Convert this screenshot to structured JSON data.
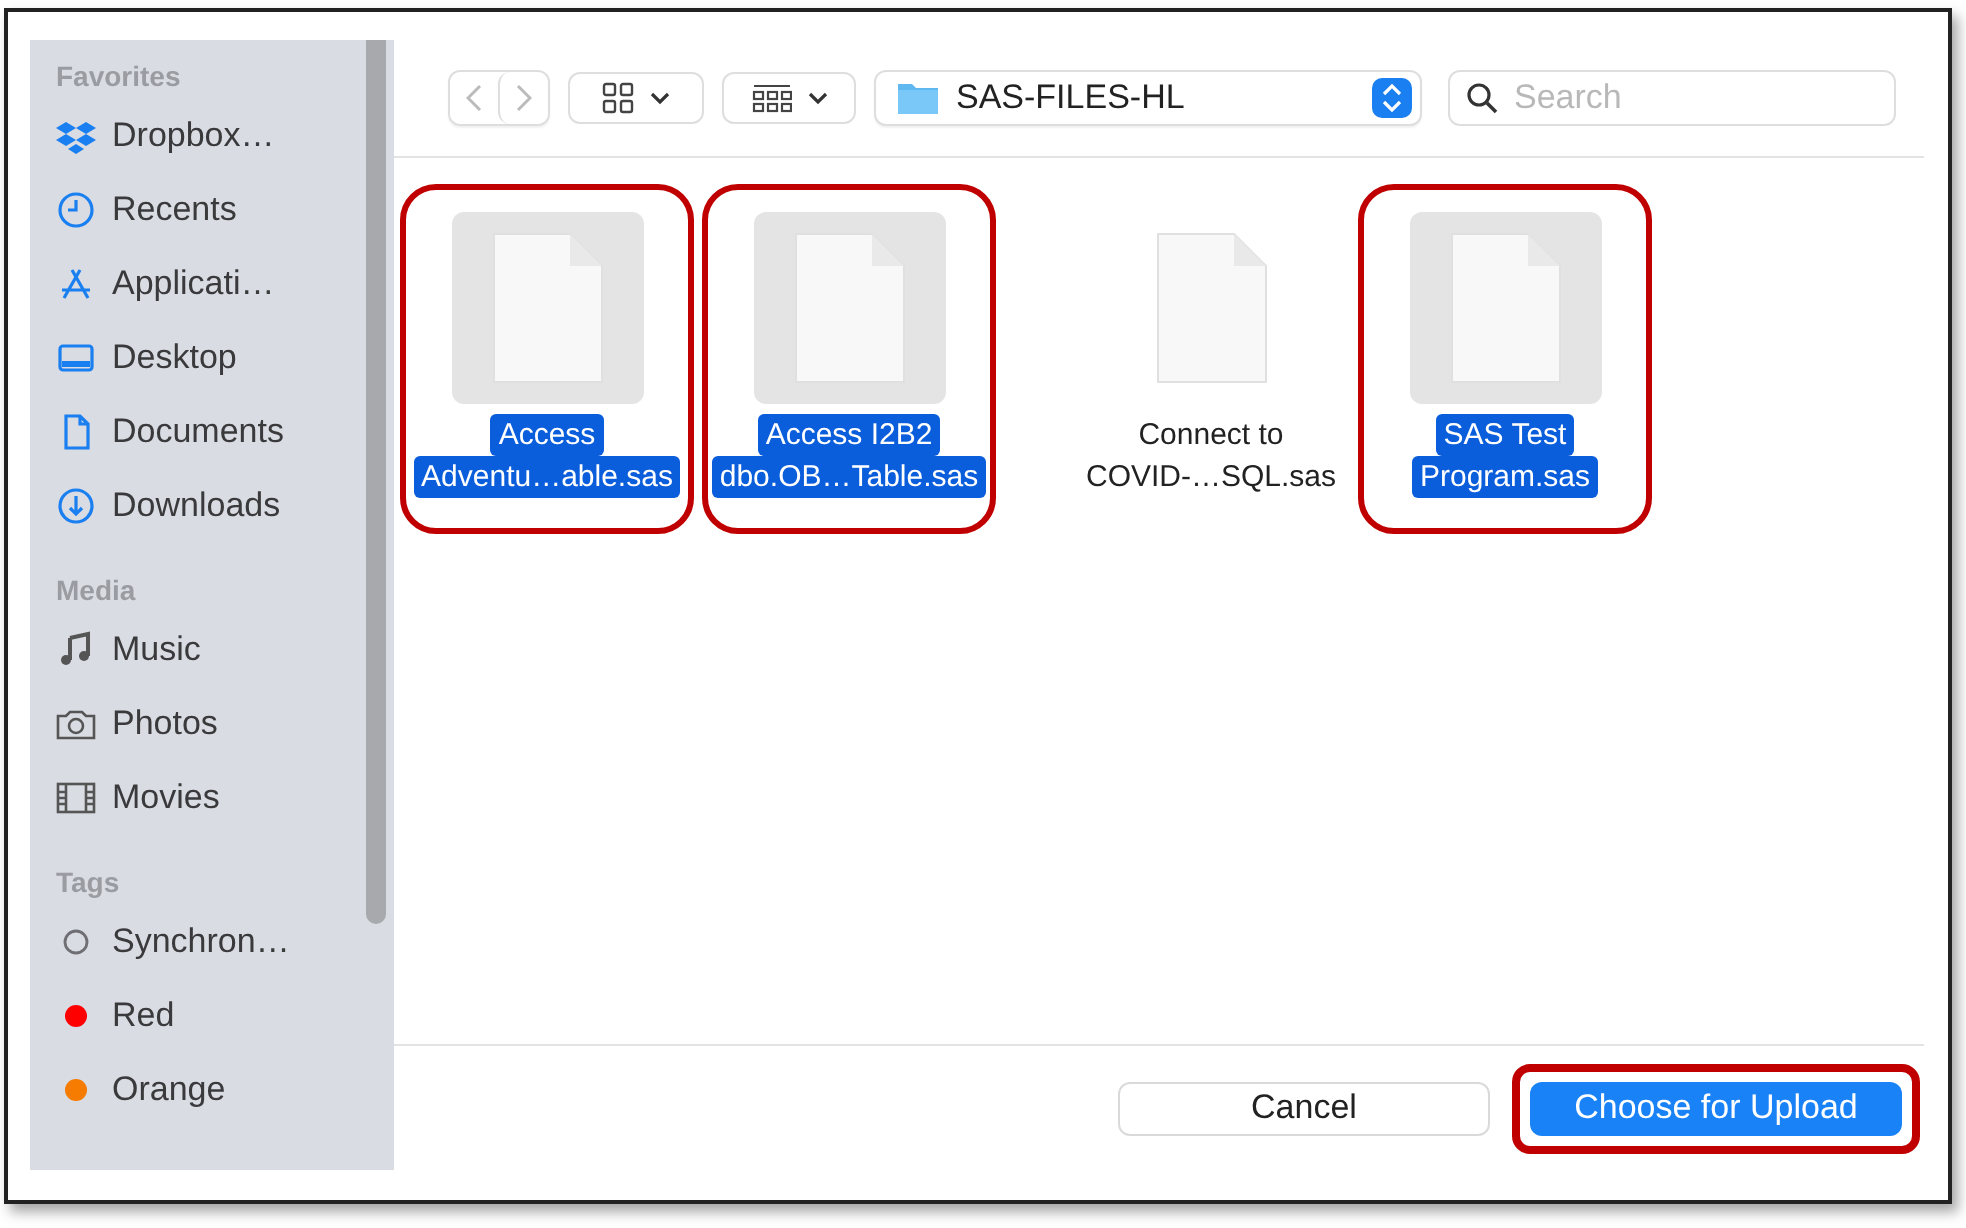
{
  "sidebar": {
    "sections": [
      {
        "title": "Favorites",
        "items": [
          {
            "label": "Dropbox…"
          },
          {
            "label": "Recents"
          },
          {
            "label": "Applicati…"
          },
          {
            "label": "Desktop"
          },
          {
            "label": "Documents"
          },
          {
            "label": "Downloads"
          }
        ]
      },
      {
        "title": "Media",
        "items": [
          {
            "label": "Music"
          },
          {
            "label": "Photos"
          },
          {
            "label": "Movies"
          }
        ]
      },
      {
        "title": "Tags",
        "items": [
          {
            "label": "Synchron…",
            "kind": "outline",
            "color": "#6e6e73"
          },
          {
            "label": "Red",
            "kind": "dot",
            "color": "#ff0000"
          },
          {
            "label": "Orange",
            "kind": "dot",
            "color": "#f57c00"
          }
        ]
      }
    ]
  },
  "toolbar": {
    "location": "SAS-FILES-HL",
    "search": {
      "placeholder": "Search"
    }
  },
  "files": [
    {
      "lines": [
        "Access",
        "Adventu…able.sas"
      ],
      "selected": true,
      "highlighted": true
    },
    {
      "lines": [
        "Access I2B2",
        "dbo.OB…Table.sas"
      ],
      "selected": true,
      "highlighted": true
    },
    {
      "lines": [
        "Connect to",
        "COVID-…SQL.sas"
      ],
      "selected": false,
      "highlighted": false
    },
    {
      "lines": [
        "SAS Test",
        "Program.sas"
      ],
      "selected": true,
      "highlighted": true
    }
  ],
  "buttons": [
    {
      "label": "Cancel",
      "kind": "secondary",
      "highlighted": false
    },
    {
      "label": "Choose for Upload",
      "kind": "primary",
      "highlighted": true
    }
  ]
}
